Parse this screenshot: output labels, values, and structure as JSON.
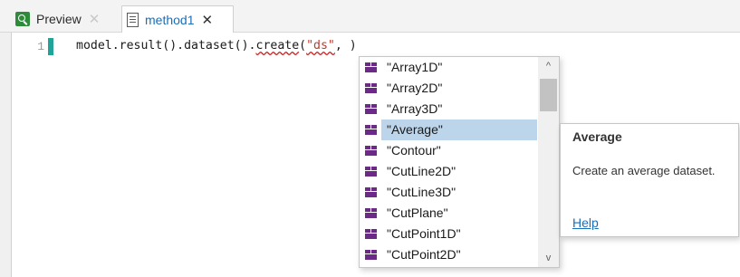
{
  "tabs": [
    {
      "label": "Preview",
      "icon": "preview-icon",
      "active": false
    },
    {
      "label": "method1",
      "icon": "method-icon",
      "active": true
    }
  ],
  "tab_close_glyph": "✕",
  "editor": {
    "line_number": "1",
    "code": {
      "prefix": "model.result().dataset().",
      "squiggle_word": "create",
      "open_paren": "(",
      "string_arg": "\"ds\"",
      "suffix": ", )"
    }
  },
  "autocomplete": {
    "items": [
      "\"Array1D\"",
      "\"Array2D\"",
      "\"Array3D\"",
      "\"Average\"",
      "\"Contour\"",
      "\"CutLine2D\"",
      "\"CutLine3D\"",
      "\"CutPlane\"",
      "\"CutPoint1D\"",
      "\"CutPoint2D\""
    ],
    "selected_index": 3,
    "item_icon": "dataset-icon",
    "scroll_up_glyph": "^",
    "scroll_down_glyph": "v"
  },
  "tooltip": {
    "title": "Average",
    "description": "Create an average dataset.",
    "link": "Help"
  },
  "colors": {
    "accent": "#1a6fb8",
    "selection": "#bcd5ea",
    "item_icon": "#6b2a86",
    "change_bar": "#22a39a",
    "string": "#c0392b"
  }
}
